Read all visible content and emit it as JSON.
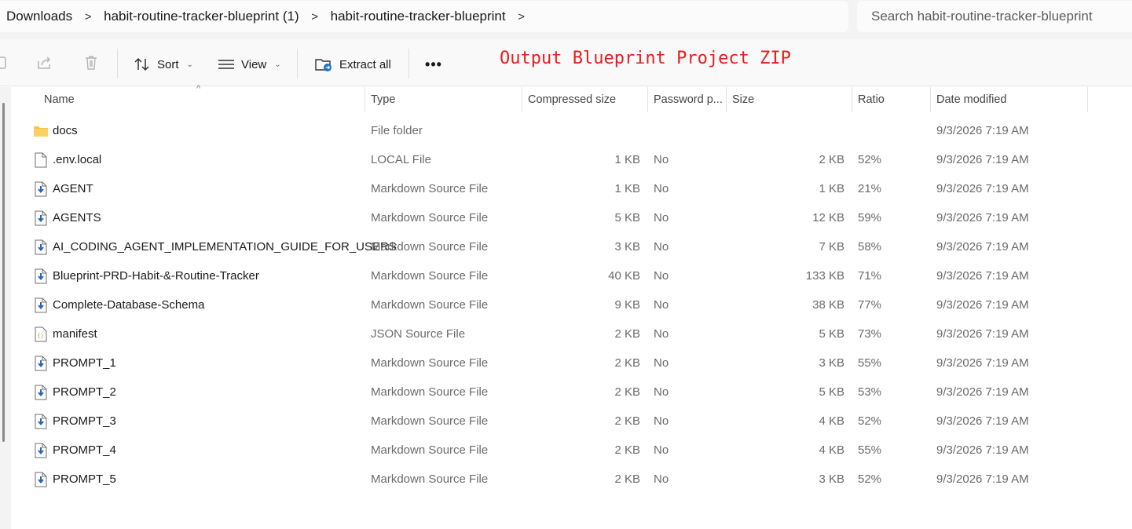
{
  "breadcrumb": {
    "items": [
      "Downloads",
      "habit-routine-tracker-blueprint (1)",
      "habit-routine-tracker-blueprint"
    ],
    "separator": ">"
  },
  "search": {
    "placeholder": "Search habit-routine-tracker-blueprint"
  },
  "toolbar": {
    "sort_label": "Sort",
    "view_label": "View",
    "extract_label": "Extract all",
    "more_label": "•••"
  },
  "overlay": {
    "title": "Output Blueprint Project ZIP",
    "color": "#e41e1e"
  },
  "columns": {
    "name": "Name",
    "type": "Type",
    "compressed": "Compressed size",
    "password": "Password p...",
    "size": "Size",
    "ratio": "Ratio",
    "date": "Date modified"
  },
  "files": [
    {
      "name": "docs",
      "icon": "folder-icon",
      "type": "File folder",
      "compressed": "",
      "password": "",
      "size": "",
      "ratio": "",
      "date": "9/3/2026 7:19 AM"
    },
    {
      "name": ".env.local",
      "icon": "file-icon",
      "type": "LOCAL File",
      "compressed": "1 KB",
      "password": "No",
      "size": "2 KB",
      "ratio": "52%",
      "date": "9/3/2026 7:19 AM"
    },
    {
      "name": "AGENT",
      "icon": "markdown-file-icon",
      "type": "Markdown Source File",
      "compressed": "1 KB",
      "password": "No",
      "size": "1 KB",
      "ratio": "21%",
      "date": "9/3/2026 7:19 AM"
    },
    {
      "name": "AGENTS",
      "icon": "markdown-file-icon",
      "type": "Markdown Source File",
      "compressed": "5 KB",
      "password": "No",
      "size": "12 KB",
      "ratio": "59%",
      "date": "9/3/2026 7:19 AM"
    },
    {
      "name": "AI_CODING_AGENT_IMPLEMENTATION_GUIDE_FOR_USERS",
      "icon": "markdown-file-icon",
      "type": "Markdown Source File",
      "compressed": "3 KB",
      "password": "No",
      "size": "7 KB",
      "ratio": "58%",
      "date": "9/3/2026 7:19 AM"
    },
    {
      "name": "Blueprint-PRD-Habit-&-Routine-Tracker",
      "icon": "markdown-file-icon",
      "type": "Markdown Source File",
      "compressed": "40 KB",
      "password": "No",
      "size": "133 KB",
      "ratio": "71%",
      "date": "9/3/2026 7:19 AM"
    },
    {
      "name": "Complete-Database-Schema",
      "icon": "markdown-file-icon",
      "type": "Markdown Source File",
      "compressed": "9 KB",
      "password": "No",
      "size": "38 KB",
      "ratio": "77%",
      "date": "9/3/2026 7:19 AM"
    },
    {
      "name": "manifest",
      "icon": "json-file-icon",
      "type": "JSON Source File",
      "compressed": "2 KB",
      "password": "No",
      "size": "5 KB",
      "ratio": "73%",
      "date": "9/3/2026 7:19 AM"
    },
    {
      "name": "PROMPT_1",
      "icon": "markdown-file-icon",
      "type": "Markdown Source File",
      "compressed": "2 KB",
      "password": "No",
      "size": "3 KB",
      "ratio": "55%",
      "date": "9/3/2026 7:19 AM"
    },
    {
      "name": "PROMPT_2",
      "icon": "markdown-file-icon",
      "type": "Markdown Source File",
      "compressed": "2 KB",
      "password": "No",
      "size": "5 KB",
      "ratio": "53%",
      "date": "9/3/2026 7:19 AM"
    },
    {
      "name": "PROMPT_3",
      "icon": "markdown-file-icon",
      "type": "Markdown Source File",
      "compressed": "2 KB",
      "password": "No",
      "size": "4 KB",
      "ratio": "52%",
      "date": "9/3/2026 7:19 AM"
    },
    {
      "name": "PROMPT_4",
      "icon": "markdown-file-icon",
      "type": "Markdown Source File",
      "compressed": "2 KB",
      "password": "No",
      "size": "4 KB",
      "ratio": "55%",
      "date": "9/3/2026 7:19 AM"
    },
    {
      "name": "PROMPT_5",
      "icon": "markdown-file-icon",
      "type": "Markdown Source File",
      "compressed": "2 KB",
      "password": "No",
      "size": "3 KB",
      "ratio": "52%",
      "date": "9/3/2026 7:19 AM"
    }
  ]
}
